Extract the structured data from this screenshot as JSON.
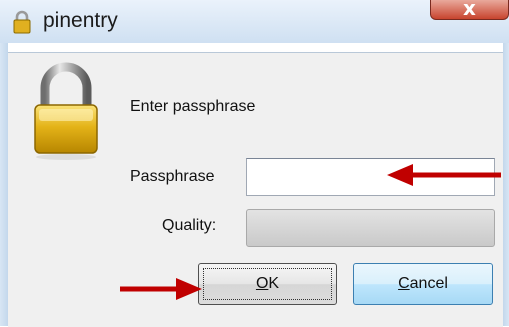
{
  "window": {
    "title": "pinentry",
    "close_glyph": "x",
    "title_icon": "lock-icon",
    "frame_color": "#cfe0f2",
    "close_color": "#c8442e"
  },
  "dialog": {
    "prompt": "Enter passphrase",
    "passphrase_label": "Passphrase",
    "passphrase_value": "",
    "quality_label": "Quality:",
    "quality_level": 0,
    "lock_icon": "padlock-icon"
  },
  "buttons": {
    "ok_accel": "O",
    "ok_rest": "K",
    "cancel_accel": "C",
    "cancel_rest": "ancel"
  },
  "annotations": {
    "arrow_color": "#c00000",
    "arrows": [
      "arrow-to-passphrase-field",
      "arrow-to-ok-button"
    ]
  }
}
